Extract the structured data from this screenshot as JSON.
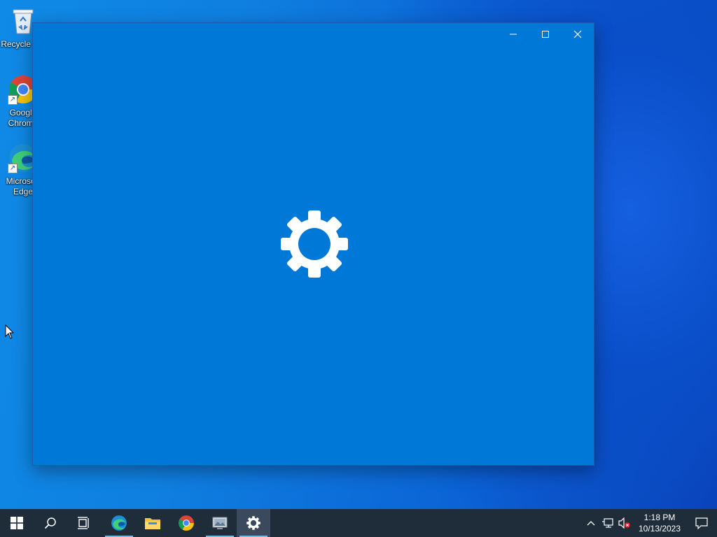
{
  "desktop": {
    "icons": [
      {
        "label": "Recycle Bin"
      },
      {
        "label": "Google Chrome"
      },
      {
        "label": "Microsoft Edge"
      }
    ]
  },
  "window": {
    "app": "Settings",
    "controls": {
      "minimize": "minimize",
      "maximize": "maximize",
      "close": "close"
    },
    "splash_icon": "gear-icon",
    "background": "#0078d7"
  },
  "taskbar": {
    "items": [
      "start",
      "search",
      "task-view",
      "microsoft-edge",
      "file-explorer",
      "google-chrome",
      "app",
      "settings"
    ],
    "active": "settings",
    "clock": {
      "time": "1:18 PM",
      "date": "10/13/2023"
    }
  }
}
